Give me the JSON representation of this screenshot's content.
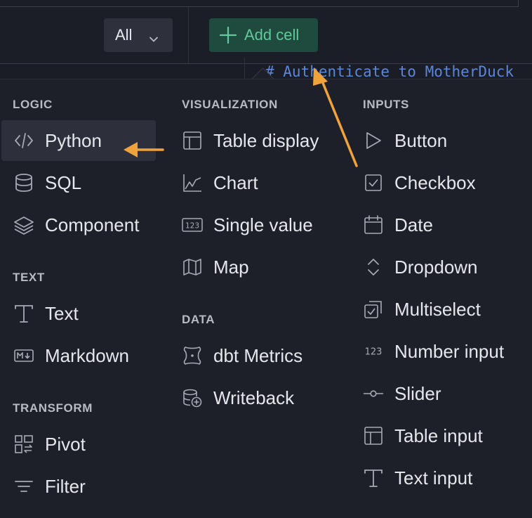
{
  "toolbar": {
    "filter_label": "All",
    "add_cell_label": "Add cell"
  },
  "editor": {
    "code_line": "# Authenticate to MotherDuck"
  },
  "menu": {
    "logic": {
      "title": "LOGIC",
      "items": [
        {
          "label": "Python",
          "icon": "code-icon"
        },
        {
          "label": "SQL",
          "icon": "database-icon"
        },
        {
          "label": "Component",
          "icon": "layers-icon"
        }
      ]
    },
    "text": {
      "title": "TEXT",
      "items": [
        {
          "label": "Text",
          "icon": "text-icon"
        },
        {
          "label": "Markdown",
          "icon": "markdown-icon"
        }
      ]
    },
    "transform": {
      "title": "TRANSFORM",
      "items": [
        {
          "label": "Pivot",
          "icon": "pivot-icon"
        },
        {
          "label": "Filter",
          "icon": "filter-icon"
        }
      ]
    },
    "visualization": {
      "title": "VISUALIZATION",
      "items": [
        {
          "label": "Table display",
          "icon": "table-icon"
        },
        {
          "label": "Chart",
          "icon": "chart-icon"
        },
        {
          "label": "Single value",
          "icon": "single-value-icon"
        },
        {
          "label": "Map",
          "icon": "map-icon"
        }
      ]
    },
    "data": {
      "title": "DATA",
      "items": [
        {
          "label": "dbt Metrics",
          "icon": "dbt-icon"
        },
        {
          "label": "Writeback",
          "icon": "writeback-icon"
        }
      ]
    },
    "inputs": {
      "title": "INPUTS",
      "items": [
        {
          "label": "Button",
          "icon": "play-icon"
        },
        {
          "label": "Checkbox",
          "icon": "checkbox-icon"
        },
        {
          "label": "Date",
          "icon": "calendar-icon"
        },
        {
          "label": "Dropdown",
          "icon": "dropdown-icon"
        },
        {
          "label": "Multiselect",
          "icon": "multiselect-icon"
        },
        {
          "label": "Number input",
          "icon": "number-icon",
          "glyph": "123"
        },
        {
          "label": "Slider",
          "icon": "slider-icon"
        },
        {
          "label": "Table input",
          "icon": "table-input-icon"
        },
        {
          "label": "Text input",
          "icon": "text-input-icon"
        }
      ]
    }
  },
  "colors": {
    "background": "#1e2029",
    "accent_green": "#62c99b",
    "annotation_orange": "#f0a23b",
    "text": "#e6e7ec",
    "icon": "#a7aab6"
  }
}
